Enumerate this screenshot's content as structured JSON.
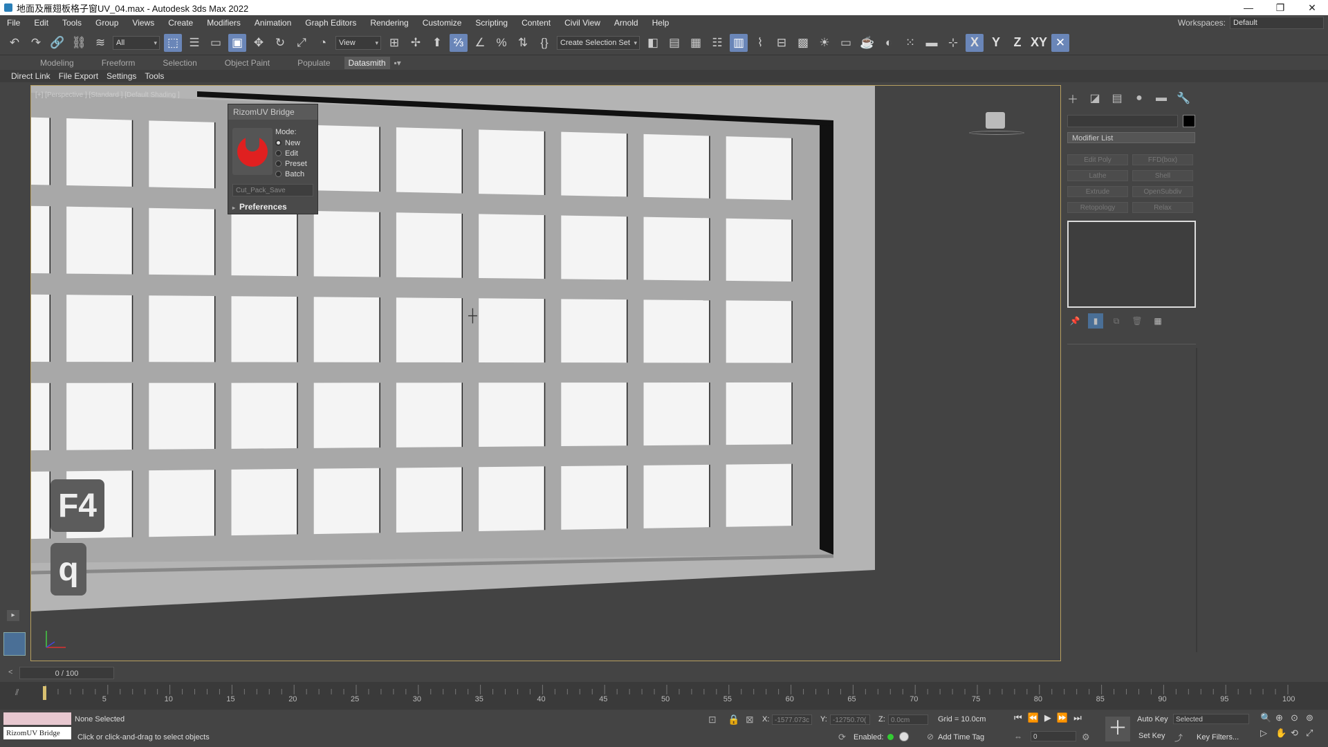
{
  "window": {
    "title": "地面及雁翅板格子窗UV_04.max - Autodesk 3ds Max 2022",
    "minimize": "—",
    "restore": "❐",
    "close": "✕"
  },
  "menu": {
    "items": [
      "File",
      "Edit",
      "Tools",
      "Group",
      "Views",
      "Create",
      "Modifiers",
      "Animation",
      "Graph Editors",
      "Rendering",
      "Customize",
      "Scripting",
      "Content",
      "Civil View",
      "Arnold",
      "Help"
    ],
    "workspaces_label": "Workspaces:",
    "workspaces_value": "Default"
  },
  "toolbar": {
    "selection_filter": "All",
    "ref_coord": "View",
    "named_selection": "Create Selection Set",
    "axis_x": "X",
    "axis_y": "Y",
    "axis_z": "Z",
    "axis_xy": "XY"
  },
  "ribbon": {
    "tabs": [
      "Modeling",
      "Freeform",
      "Selection",
      "Object Paint",
      "Populate",
      "Datasmith"
    ]
  },
  "subbar": {
    "items": [
      "Direct Link",
      "File Export",
      "Settings",
      "Tools"
    ]
  },
  "viewport": {
    "label": "[+] [Perspective ] [Standard ] [Default Shading ]",
    "window_rows": 5,
    "window_cols": 10
  },
  "rizom": {
    "title": "RizomUV Bridge",
    "mode_label": "Mode:",
    "modes": [
      "New",
      "Edit",
      "Preset",
      "Batch"
    ],
    "selected_mode": "New",
    "preset_value": "Cut_Pack_Save",
    "preferences_label": "Preferences"
  },
  "keys": {
    "key1": "F4",
    "key2": "q"
  },
  "command_panel": {
    "modifier_list": "Modifier List",
    "buttons": [
      "Edit Poly",
      "FFD(box)",
      "Lathe",
      "Shell",
      "Extrude",
      "OpenSubdiv",
      "Retopology",
      "Relax"
    ]
  },
  "time": {
    "slider": "0 / 100",
    "ticks": [
      "5",
      "10",
      "15",
      "20",
      "25",
      "30",
      "35",
      "40",
      "45",
      "50",
      "55",
      "60",
      "65",
      "70",
      "75",
      "80",
      "85",
      "90",
      "95",
      "100"
    ]
  },
  "status": {
    "selection": "None Selected",
    "prompt": "Click or click-and-drag to select objects",
    "script_label": "RizomUV Bridge",
    "x_label": "X:",
    "x_value": "-1577.073c",
    "y_label": "Y:",
    "y_value": "-12750.70(",
    "z_label": "Z:",
    "z_value": "0.0cm",
    "grid": "Grid = 10.0cm",
    "enabled_label": "Enabled:",
    "add_time_tag": "Add Time Tag",
    "auto_key": "Auto Key",
    "set_key": "Set Key",
    "selected": "Selected",
    "key_filters": "Key Filters...",
    "frame": "0"
  },
  "colors": {
    "accent": "#6a86b8",
    "viewport_border": "#b8a060",
    "rizom_logo": "#e02020"
  }
}
